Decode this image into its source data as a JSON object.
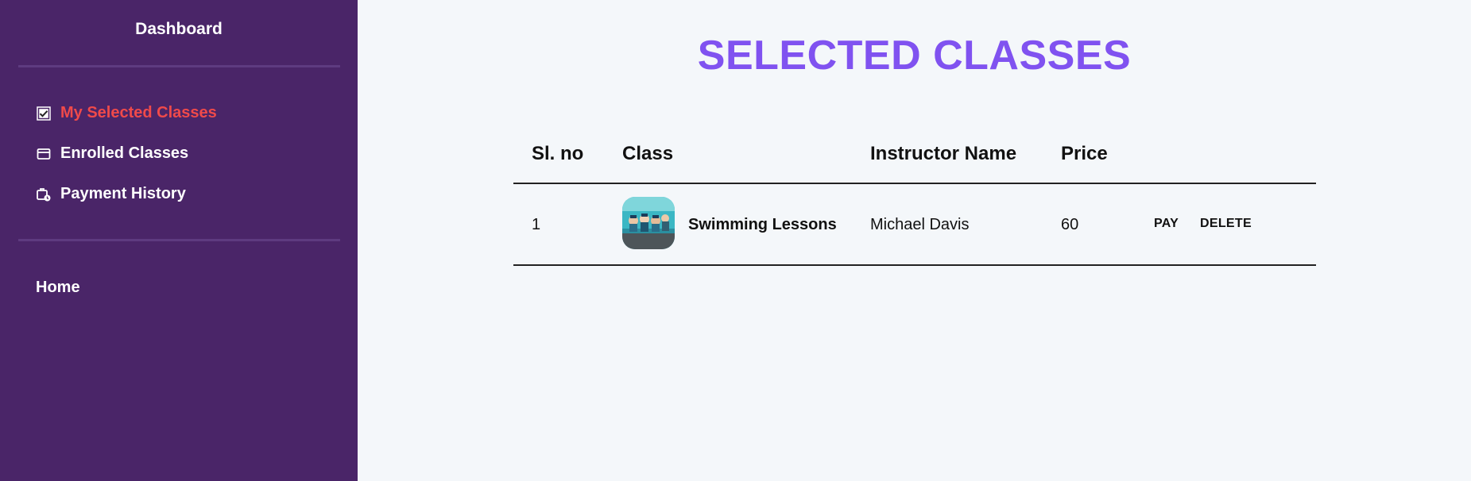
{
  "sidebar": {
    "title": "Dashboard",
    "items": [
      {
        "label": "My Selected Classes",
        "icon": "checkbox-icon",
        "active": true
      },
      {
        "label": "Enrolled Classes",
        "icon": "card-icon",
        "active": false
      },
      {
        "label": "Payment History",
        "icon": "payment-history-icon",
        "active": false
      }
    ],
    "home_label": "Home"
  },
  "main": {
    "title": "SELECTED CLASSES"
  },
  "table": {
    "columns": [
      "Sl. no",
      "Class",
      "Instructor Name",
      "Price"
    ],
    "rows": [
      {
        "sl_no": "1",
        "class_name": "Swimming Lessons",
        "instructor": "Michael Davis",
        "price": "60",
        "pay_label": "PAY",
        "delete_label": "DELETE"
      }
    ]
  },
  "colors": {
    "sidebar_bg": "#4a2568",
    "active_item": "#f04a4a",
    "title": "#8052f0",
    "page_bg": "#f4f7fa"
  }
}
